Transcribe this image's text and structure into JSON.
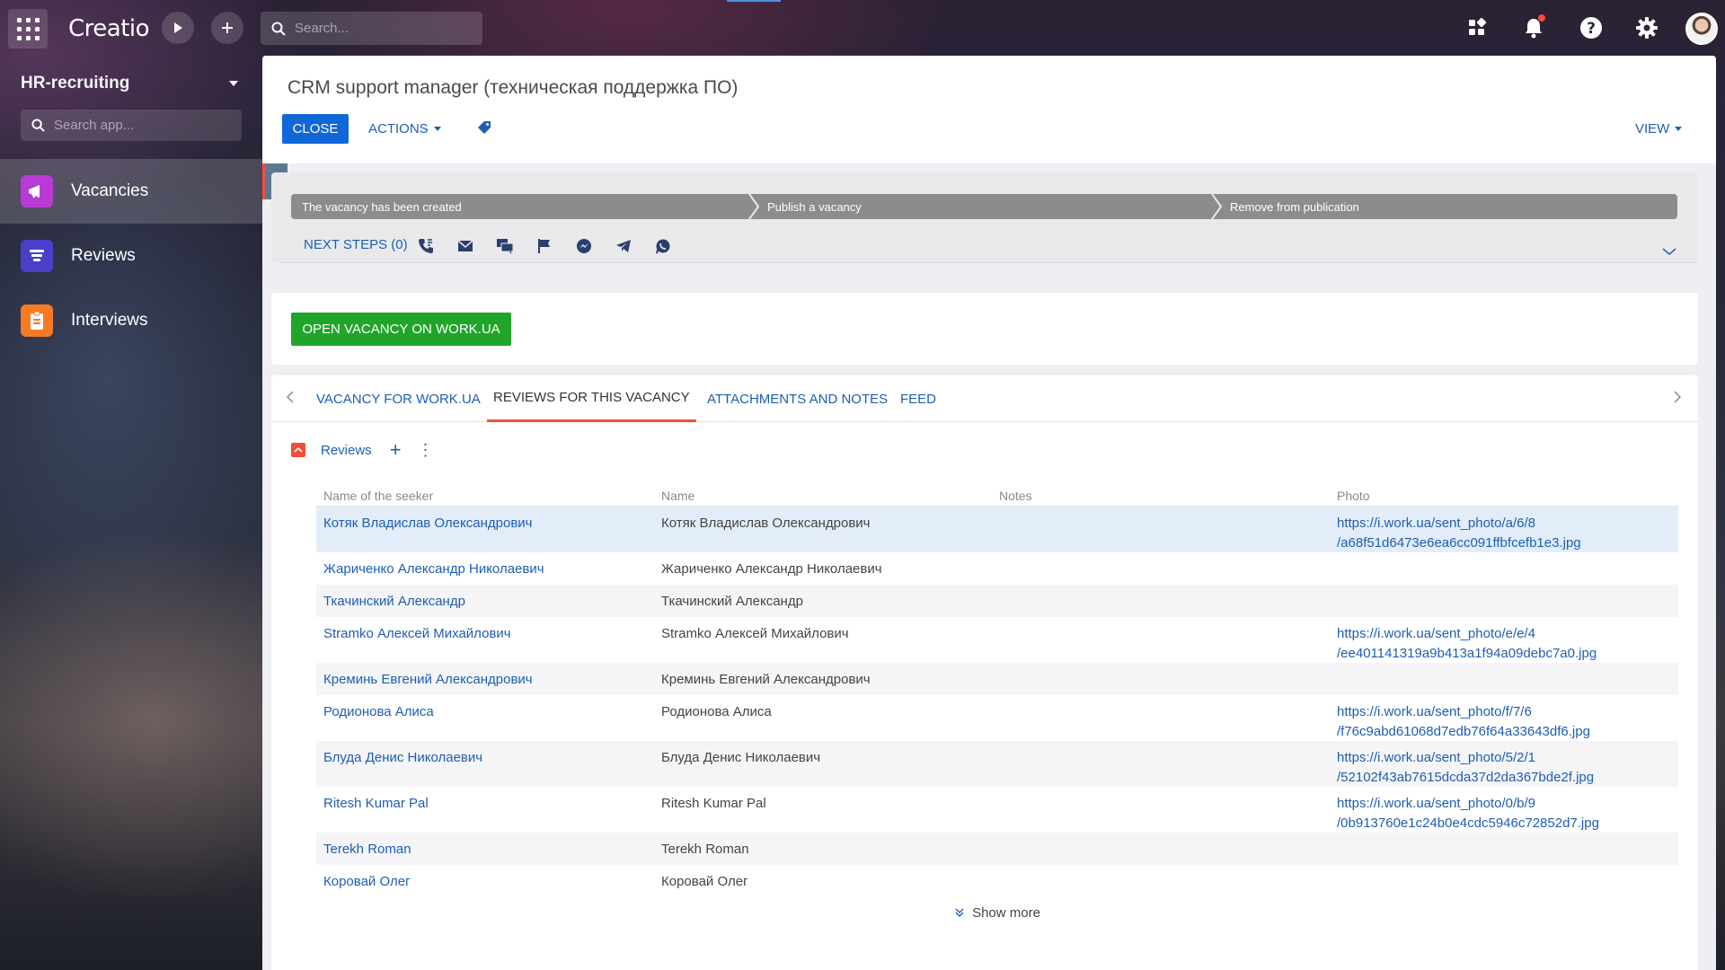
{
  "topbar": {
    "logo": "Creatio",
    "search_placeholder": "Search..."
  },
  "sidebar": {
    "workspace": "HR-recruiting",
    "search_placeholder": "Search app...",
    "items": [
      {
        "label": "Vacancies",
        "icon": "megaphone-icon",
        "color": "#b83bd6"
      },
      {
        "label": "Reviews",
        "icon": "filter-icon",
        "color": "#4b3fc9"
      },
      {
        "label": "Interviews",
        "icon": "clipboard-icon",
        "color": "#f77a25"
      }
    ]
  },
  "page": {
    "title": "CRM support manager (техническая поддержка ПО)",
    "close_label": "CLOSE",
    "actions_label": "ACTIONS",
    "view_label": "VIEW"
  },
  "stages": {
    "items": [
      "The vacancy has been created",
      "Publish a vacancy",
      "Remove from publication"
    ],
    "next_steps": "NEXT STEPS (0)",
    "icons": [
      "phone-icon",
      "email-icon",
      "chat-icon",
      "flag-icon",
      "messenger-icon",
      "telegram-icon",
      "whatsapp-icon"
    ]
  },
  "action": {
    "open_label": "OPEN VACANCY ON WORK.UA"
  },
  "tabs": [
    "VACANCY FOR WORK.UA",
    "REVIEWS FOR THIS VACANCY",
    "ATTACHMENTS AND NOTES",
    "FEED"
  ],
  "reviews": {
    "title": "Reviews",
    "columns": [
      "Name of the seeker",
      "Name",
      "Notes",
      "Photo"
    ],
    "rows": [
      {
        "seeker": "Котяк Владислав Олександрович",
        "name": "Котяк Владислав Олександрович",
        "notes": "",
        "photo": "https://i.work.ua/sent_photo/a/6/8 /a68f51d6473e6ea6cc091ffbfcefb1e3.jpg"
      },
      {
        "seeker": "Жариченко Александр Николаевич",
        "name": "Жариченко Александр Николаевич",
        "notes": "",
        "photo": ""
      },
      {
        "seeker": "Ткачинский Александр",
        "name": "Ткачинский Александр",
        "notes": "",
        "photo": ""
      },
      {
        "seeker": "Stramko Алексей Михайлович",
        "name": "Stramko Алексей Михайлович",
        "notes": "",
        "photo": "https://i.work.ua/sent_photo/e/e/4 /ee401141319a9b413a1f94a09debc7a0.jpg"
      },
      {
        "seeker": "Креминь Евгений Александрович",
        "name": "Креминь Евгений Александрович",
        "notes": "",
        "photo": ""
      },
      {
        "seeker": "Родионова Алиса",
        "name": "Родионова Алиса",
        "notes": "",
        "photo": "https://i.work.ua/sent_photo/f/7/6 /f76c9abd61068d7edb76f64a33643df6.jpg"
      },
      {
        "seeker": "Блуда Денис Николаевич",
        "name": "Блуда Денис Николаевич",
        "notes": "",
        "photo": "https://i.work.ua/sent_photo/5/2/1 /52102f43ab7615dcda37d2da367bde2f.jpg"
      },
      {
        "seeker": "Ritesh Kumar Pal",
        "name": "Ritesh Kumar Pal",
        "notes": "",
        "photo": "https://i.work.ua/sent_photo/0/b/9 /0b913760e1c24b0e4cdc5946c72852d7.jpg"
      },
      {
        "seeker": "Terekh Roman",
        "name": "Terekh Roman",
        "notes": "",
        "photo": ""
      },
      {
        "seeker": "Коровай Олег",
        "name": "Коровай Олег",
        "notes": "",
        "photo": ""
      }
    ],
    "show_more": "Show more"
  }
}
